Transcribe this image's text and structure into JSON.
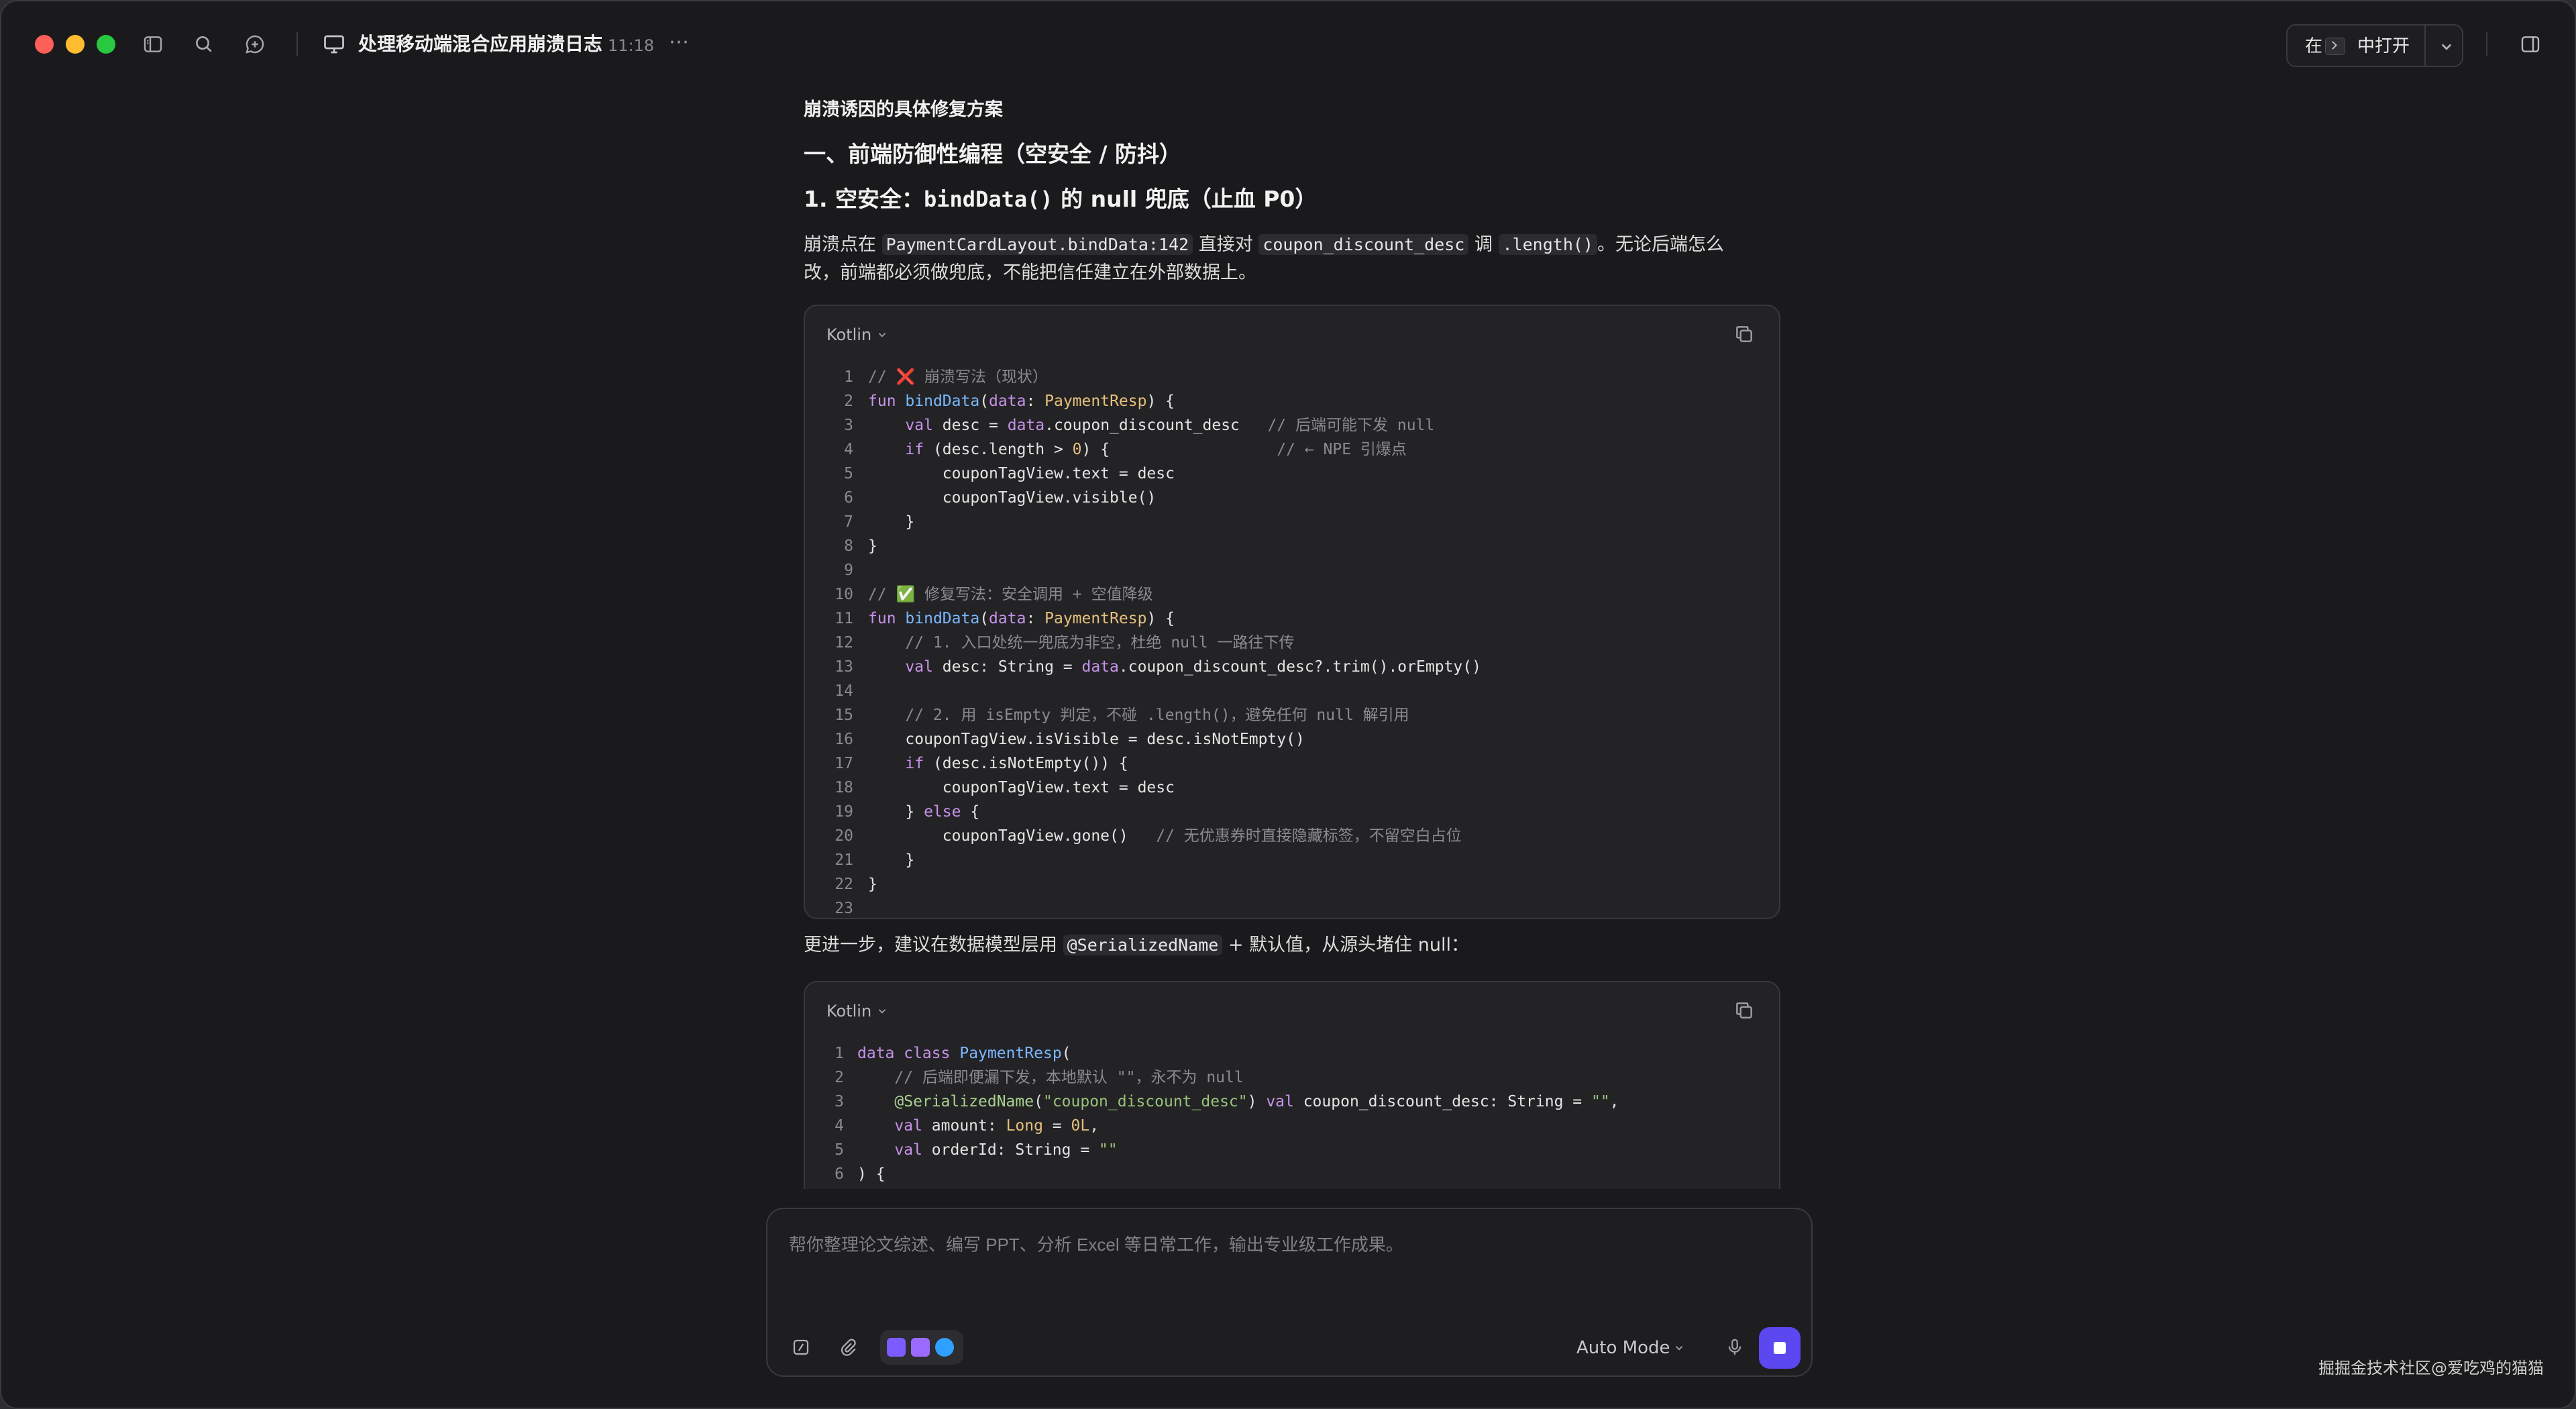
{
  "titlebar": {
    "title": "处理移动端混合应用崩溃日志",
    "time": "11:18",
    "more": "⋯",
    "open_in_prefix": "在",
    "open_in_suffix": "中打开"
  },
  "content": {
    "heading_small": "崩溃诱因的具体修复方案",
    "heading_one": "一、前端防御性编程（空安全 / 防抖）",
    "heading_two_prefix": "1. 空安全：",
    "heading_two_code": "bindData()",
    "heading_two_suffix": " 的 null 兜底（止血 P0）",
    "para1": {
      "t1": "崩溃点在 ",
      "c1": "PaymentCardLayout.bindData:142",
      "t2": " 直接对 ",
      "c2": "coupon_discount_desc",
      "t3": " 调 ",
      "c3": ".length()",
      "t4": "。无论后端怎么改，前端都必须做兜底，不能把信任建立在外部数据上。"
    },
    "para2": {
      "t1": "更进一步，建议在数据模型层用 ",
      "c1": "@SerializedName",
      "t2": " + 默认值，从源头堵住 null："
    }
  },
  "codeblock1": {
    "language": "Kotlin",
    "line_numbers": [
      "1",
      "2",
      "3",
      "4",
      "5",
      "6",
      "7",
      "8",
      "9",
      "10",
      "11",
      "12",
      "13",
      "14",
      "15",
      "16",
      "17",
      "18",
      "19",
      "20",
      "21",
      "22",
      "23"
    ]
  },
  "codeblock2": {
    "language": "Kotlin",
    "line_numbers": [
      "1",
      "2",
      "3",
      "4",
      "5",
      "6"
    ]
  },
  "composer": {
    "placeholder": "帮你整理论文综述、编写 PPT、分析 Excel 等日常工作，输出专业级工作成果。",
    "mode": "Auto Mode"
  },
  "watermark": "掘掘金技术社区@爱吃鸡的猫猫",
  "icons": {
    "sidebar_toggle": "sidebar-icon",
    "search": "search-icon",
    "new_chat": "new-chat-icon",
    "monitor": "monitor-icon",
    "copy": "copy-icon",
    "panel": "panel-icon",
    "attach": "paperclip-icon",
    "slash": "slash-command-icon",
    "mic": "mic-icon",
    "send": "stop-icon"
  },
  "colors": {
    "accent": "#5b48f0",
    "background": "#1a1a1c",
    "code_bg": "#232326"
  }
}
